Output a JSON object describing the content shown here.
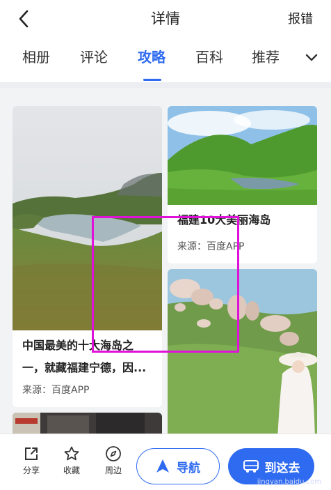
{
  "header": {
    "title": "详情",
    "report_label": "报错"
  },
  "tabs": [
    {
      "label": "相册",
      "active": false
    },
    {
      "label": "评论",
      "active": false
    },
    {
      "label": "攻略",
      "active": true
    },
    {
      "label": "百科",
      "active": false
    },
    {
      "label": "推荐",
      "active": false
    }
  ],
  "cards": [
    {
      "title_line1": "中国最美的十大海岛之",
      "title_line2": "一，就藏福建宁德，因...",
      "source": "来源：百度APP"
    },
    {
      "title": "福建10大美丽海岛",
      "source": "来源：百度APP"
    }
  ],
  "bottom": {
    "share": "分享",
    "favorite": "收藏",
    "nearby": "周边",
    "navigate": "导航",
    "go_here": "到这去"
  },
  "watermark": "jingyan.baidu.com",
  "colors": {
    "accent": "#2f6bf0",
    "highlight": "#e012d9"
  }
}
